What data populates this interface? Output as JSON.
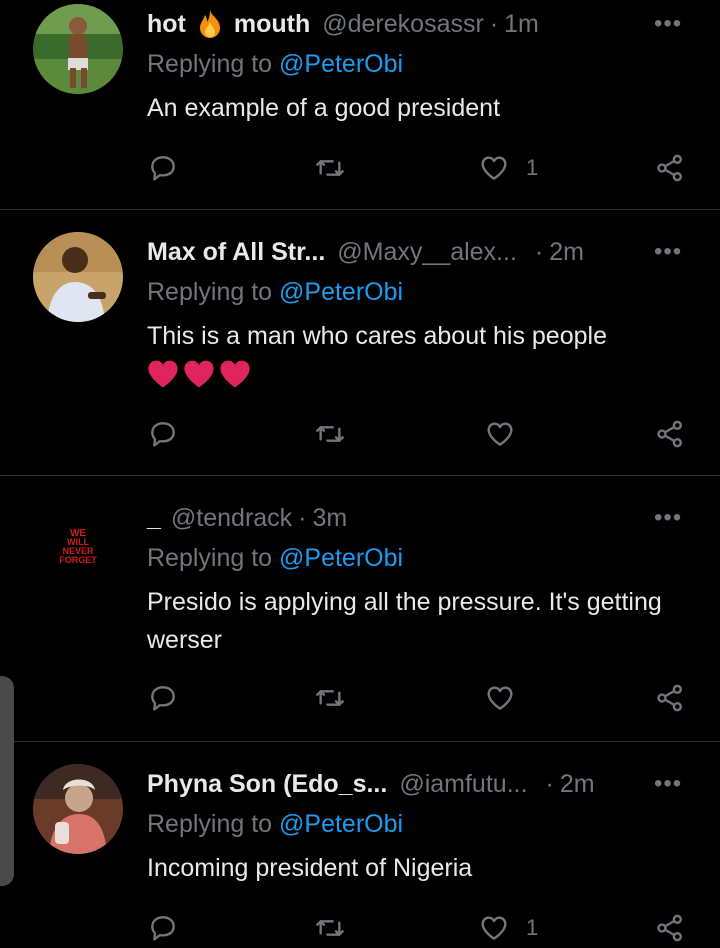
{
  "tweets": [
    {
      "name_part1": "hot",
      "name_part2": "mouth",
      "handle": "@derekosassr",
      "sep": "·",
      "time": "1m",
      "reply_prefix": "Replying to",
      "reply_to": "@PeterObi",
      "text": "An example of a good president",
      "like_count": "1",
      "more": "•••"
    },
    {
      "name": "Max of All Str...",
      "handle": "@Maxy__alex...",
      "sep": "·",
      "time": "2m",
      "reply_prefix": "Replying to",
      "reply_to": "@PeterObi",
      "text": "This is a man who cares about his people",
      "more": "•••"
    },
    {
      "name": "_",
      "handle": "@tendrack",
      "sep": "·",
      "time": "3m",
      "reply_prefix": "Replying to",
      "reply_to": "@PeterObi",
      "text": "Presido is applying all the pressure. It's getting werser",
      "avatar_text": [
        "WE",
        "WILL",
        "NEVER",
        "FORGET"
      ],
      "more": "•••"
    },
    {
      "name": "Phyna Son (Edo_s...",
      "handle": "@iamfutu...",
      "sep": "·",
      "time": "2m",
      "reply_prefix": "Replying to",
      "reply_to": "@PeterObi",
      "text": "Incoming president of Nigeria",
      "like_count": "1",
      "more": "•••"
    }
  ],
  "colors": {
    "background": "#000000",
    "text": "#e7e9ea",
    "muted": "#71767b",
    "mention": "#1d9bf0",
    "heart_emoji": "#e0245e"
  },
  "icons": [
    "reply-icon",
    "retweet-icon",
    "like-icon",
    "share-icon",
    "more-icon",
    "fire-emoji-icon",
    "red-heart-emoji-icon"
  ]
}
